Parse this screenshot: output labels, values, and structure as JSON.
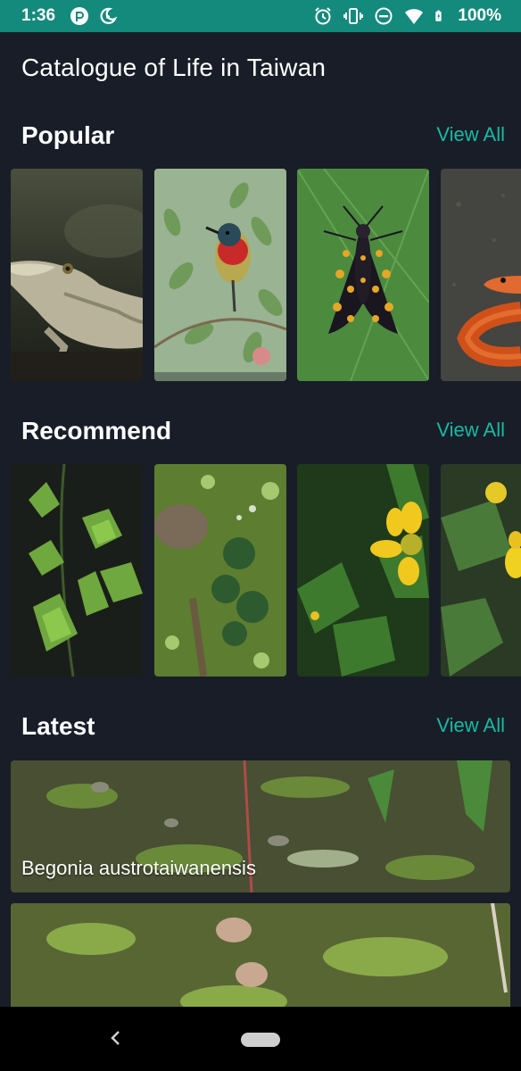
{
  "status": {
    "time": "1:36",
    "battery": "100%"
  },
  "app": {
    "title": "Catalogue of Life in Taiwan"
  },
  "sections": {
    "popular": {
      "title": "Popular",
      "view_all": "View All"
    },
    "recommend": {
      "title": "Recommend",
      "view_all": "View All"
    },
    "latest": {
      "title": "Latest",
      "view_all": "View All"
    }
  },
  "latest_items": [
    {
      "name": "Begonia austrotaiwanensis"
    },
    {
      "name": ""
    }
  ],
  "icons": {
    "status": [
      "notification-app-icon",
      "notification-moon-icon",
      "alarm-icon",
      "vibrate-icon",
      "do-not-disturb-icon",
      "wifi-icon",
      "battery-icon"
    ],
    "nav": [
      "back-icon",
      "home-pill-icon"
    ]
  },
  "colors": {
    "background": "#181d28",
    "statusbar": "#148a7c",
    "accent": "#19b9a3"
  }
}
